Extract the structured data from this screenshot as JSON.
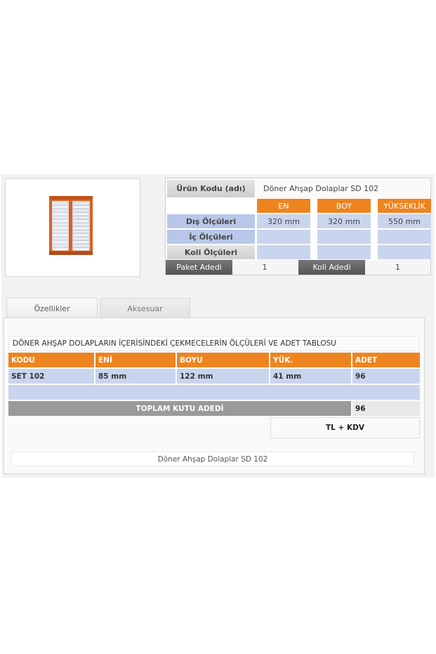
{
  "product": {
    "image_alt_icon": "rotating-wooden-drawer-cabinet",
    "code_label": "Ürün Kodu (adı)",
    "code_value": "Döner Ahşap Dolaplar SD 102"
  },
  "dimensions": {
    "columns": [
      "EN",
      "BOY",
      "YÜKSEKLİK"
    ],
    "rows": [
      {
        "label": "Dış Ölçüleri",
        "values": [
          "320 mm",
          "320 mm",
          "550 mm"
        ]
      },
      {
        "label": "İç Ölçüleri",
        "values": [
          "",
          "",
          ""
        ]
      },
      {
        "label": "Koli Ölçüleri",
        "values": [
          "",
          "",
          ""
        ]
      }
    ],
    "paket_label": "Paket Adedi",
    "paket_value": "1",
    "koli_label": "Koli Adedi",
    "koli_value": "1"
  },
  "tabs": [
    {
      "label": "Özellikler",
      "active": true
    },
    {
      "label": "Aksesuar",
      "active": false
    }
  ],
  "table": {
    "heading": "DÖNER AHŞAP DOLAPLARIN İÇERİSİNDEKİ ÇEKMECELERİN ÖLÇÜLERİ VE ADET TABLOSU",
    "headers": [
      "KODU",
      "ENİ",
      "BOYU",
      "YÜK.",
      "ADET"
    ],
    "rows": [
      [
        "SET 102",
        "85 mm",
        "122 mm",
        "41 mm",
        "96"
      ]
    ],
    "total_label": "TOPLAM KUTU ADEDİ",
    "total_value": "96",
    "price_label": "TL + KDV"
  },
  "footer": {
    "caption": "Döner Ahşap Dolaplar SD 102"
  },
  "colors": {
    "accent": "#ee8420",
    "row_blue": "#c9d4ee",
    "dark_label": "#555555"
  }
}
